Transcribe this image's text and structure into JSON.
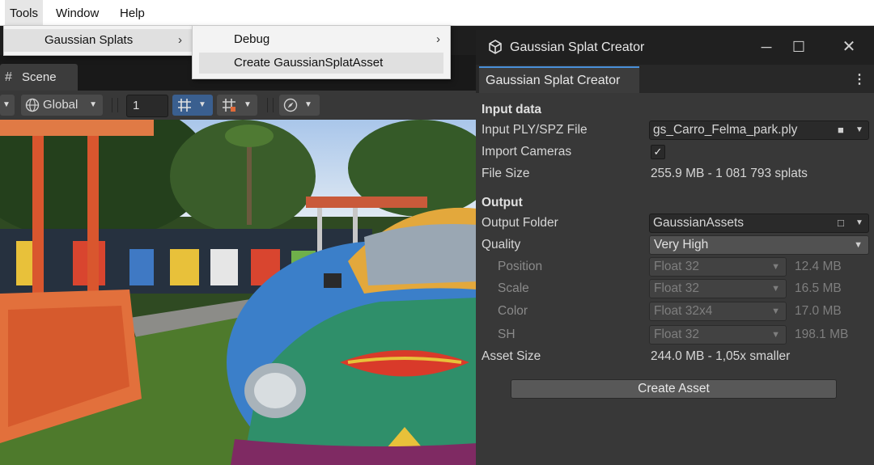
{
  "menubar": {
    "items": [
      "Tools",
      "Window",
      "Help"
    ]
  },
  "tools_menu": {
    "item": "Gaussian Splats",
    "arrow": "›"
  },
  "submenu": {
    "debug": "Debug",
    "debug_arrow": "›",
    "create": "Create GaussianSplatAsset"
  },
  "scene": {
    "tab_label": "Scene",
    "tab_icon": "#",
    "toolbar": {
      "global_label": "Global",
      "grid_value": "1"
    }
  },
  "window": {
    "title": "Gaussian Splat Creator",
    "tab_label": "Gaussian Splat Creator",
    "kebab": "⋮",
    "sections": {
      "input": "Input data",
      "output": "Output"
    },
    "input_file": {
      "label": "Input PLY/SPZ File",
      "value": "gs_Carro_Felma_park.ply"
    },
    "import_cameras": {
      "label": "Import Cameras",
      "checked": true,
      "mark": "✓"
    },
    "file_size": {
      "label": "File Size",
      "value": "255.9 MB - 1 081 793 splats"
    },
    "output_folder": {
      "label": "Output Folder",
      "value": "GaussianAssets"
    },
    "quality": {
      "label": "Quality",
      "value": "Very High"
    },
    "rows": [
      {
        "label": "Position",
        "format": "Float 32",
        "size": "12.4 MB"
      },
      {
        "label": "Scale",
        "format": "Float 32",
        "size": "16.5 MB"
      },
      {
        "label": "Color",
        "format": "Float 32x4",
        "size": "17.0 MB"
      },
      {
        "label": "SH",
        "format": "Float 32",
        "size": "198.1 MB"
      }
    ],
    "asset_size": {
      "label": "Asset Size",
      "value": "244.0 MB - 1,05x smaller"
    },
    "create_button": "Create Asset"
  },
  "colors": {
    "accent": "#4a90d9",
    "panel": "#383838",
    "titlebar": "#202020"
  }
}
